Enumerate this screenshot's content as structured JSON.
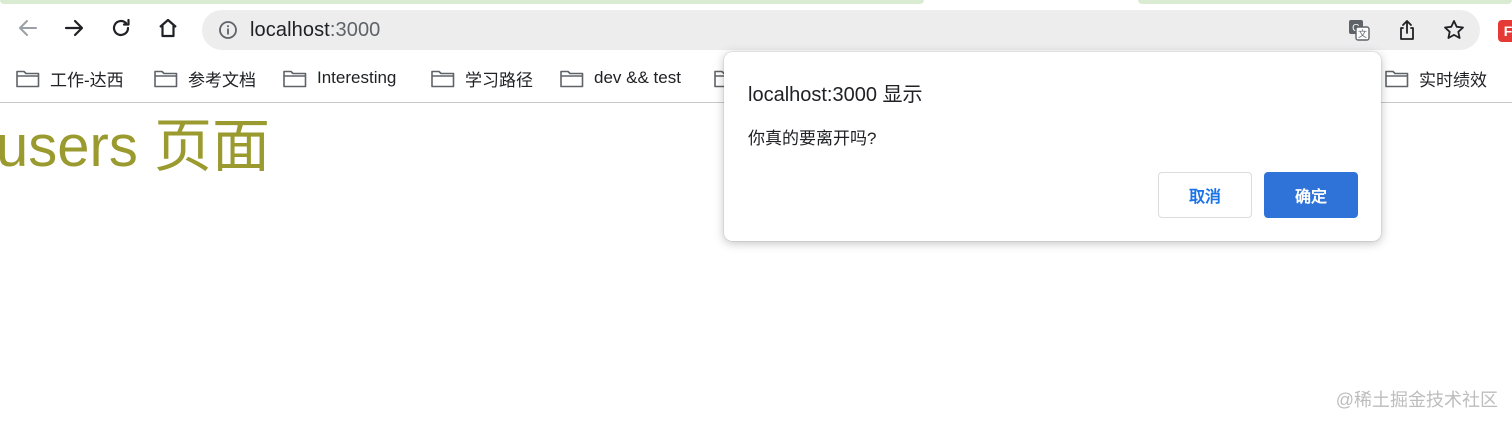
{
  "browser": {
    "url_host": "localhost",
    "url_port": ":3000"
  },
  "bookmarks": [
    {
      "label": "工作-达西"
    },
    {
      "label": "参考文档"
    },
    {
      "label": "Interesting"
    },
    {
      "label": "学习路径"
    },
    {
      "label": "dev && test"
    },
    {
      "label": "实时绩效"
    }
  ],
  "page": {
    "title": "users 页面"
  },
  "dialog": {
    "title": "localhost:3000 显示",
    "message": "你真的要离开吗?",
    "cancel_label": "取消",
    "ok_label": "确定"
  },
  "extension": {
    "letter": "F"
  },
  "watermark": "@稀土掘金技术社区",
  "colors": {
    "page_title": "#9a9a2e",
    "primary_button": "#2f73d8",
    "extension": "#e53935"
  }
}
